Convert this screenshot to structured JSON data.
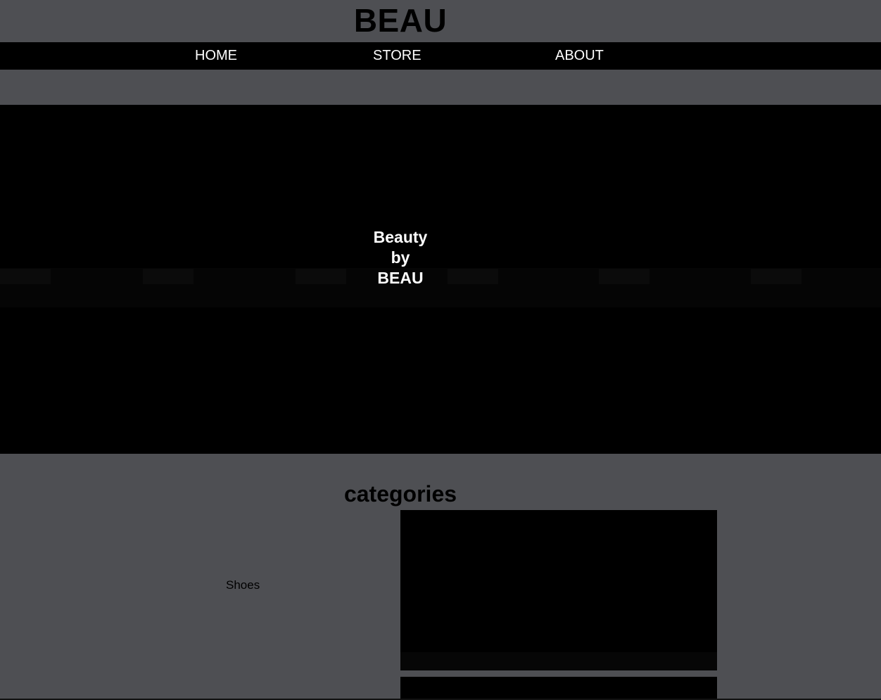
{
  "header": {
    "brand": "BEAU"
  },
  "nav": {
    "items": [
      {
        "label": "HOME"
      },
      {
        "label": "STORE"
      },
      {
        "label": "ABOUT"
      }
    ]
  },
  "hero": {
    "title_lines": [
      "Beauty",
      "by",
      "BEAU"
    ]
  },
  "categories": {
    "title": "categories",
    "items": [
      {
        "label": "Shoes"
      }
    ]
  },
  "colors": {
    "page_background": "#4e4f53",
    "nav_background": "#000000",
    "hero_background": "#000000",
    "nav_text": "#ffffff",
    "hero_text": "#ffffff",
    "heading_text": "#000000"
  }
}
